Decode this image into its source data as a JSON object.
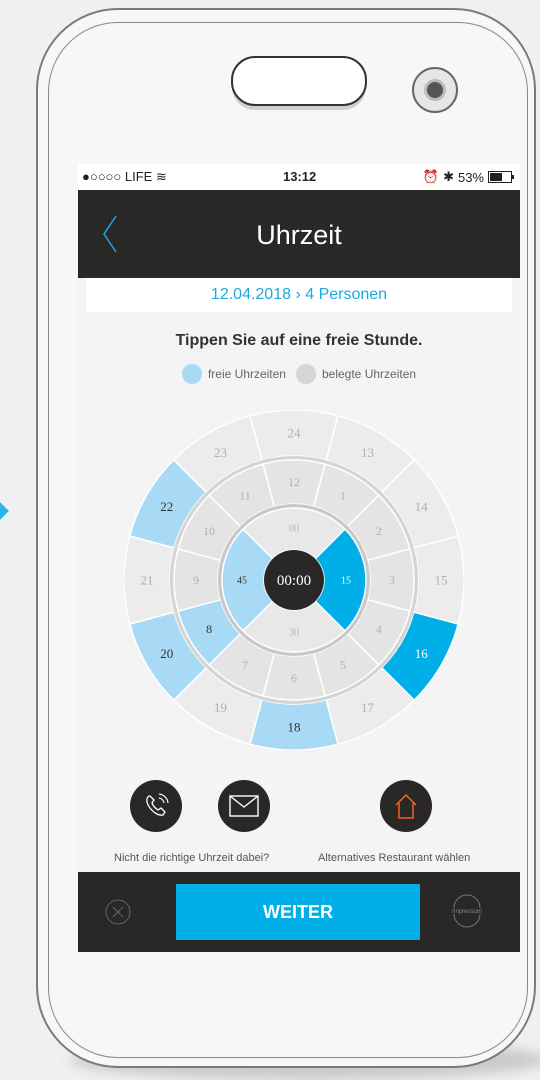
{
  "status": {
    "carrier": "●○○○○ LIFE",
    "time": "13:12",
    "battery": "53%"
  },
  "header": {
    "title": "Uhrzeit"
  },
  "subheader": {
    "text": "12.04.2018 › 4 Personen"
  },
  "instruction": "Tippen Sie auf eine freie Stunde.",
  "legend": {
    "free": "freie Uhrzeiten",
    "taken": "belegte Uhrzeiten"
  },
  "colors": {
    "free": "#a8daf5",
    "selected": "#00aee8",
    "taken": "#e6e6e6",
    "dark": "#2a2727"
  },
  "dial": {
    "center": "00:00",
    "outer": [
      "24",
      "13",
      "14",
      "15",
      "16",
      "17",
      "18",
      "19",
      "20",
      "21",
      "22",
      "23"
    ],
    "outer_free": [
      "18",
      "20",
      "22"
    ],
    "outer_selected": [
      "16"
    ],
    "inner": [
      "12",
      "1",
      "2",
      "3",
      "4",
      "5",
      "6",
      "7",
      "8",
      "9",
      "10",
      "11"
    ],
    "inner_free": [
      "8"
    ],
    "minutes": [
      "00",
      "15",
      "30",
      "45"
    ],
    "minutes_free": [
      "45"
    ],
    "minutes_selected": [
      "15"
    ]
  },
  "actions": {
    "call_label": "Nicht die richtige Uhrzeit dabei?",
    "alt_label": "Alternatives Restaurant wählen"
  },
  "bottom": {
    "weiter": "WEITER",
    "impressum": "Impressum"
  }
}
